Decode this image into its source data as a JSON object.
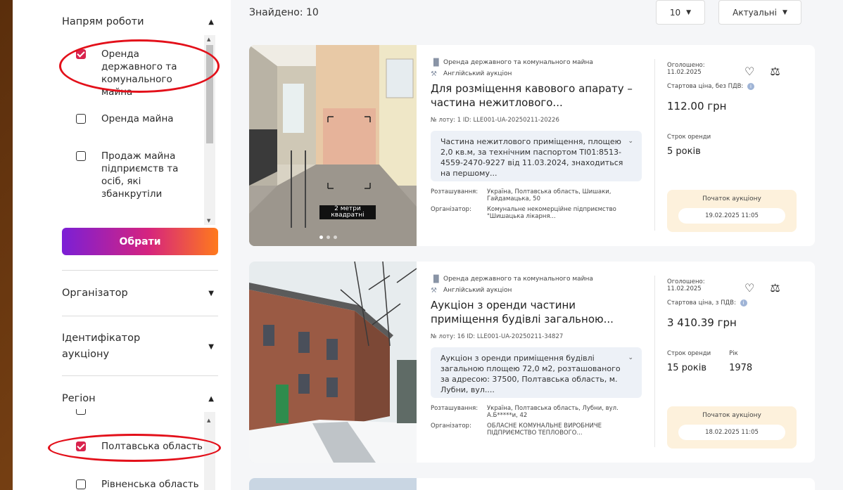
{
  "sidebar": {
    "sections": {
      "direction": {
        "title": "Напрям роботи"
      },
      "organizer": {
        "title": "Організатор"
      },
      "auction_id": {
        "title": "Ідентифікатор аукціону"
      },
      "region": {
        "title": "Регіон"
      }
    },
    "direction_options": [
      {
        "label": "Оренда державного та комунального майна",
        "checked": true
      },
      {
        "label": "Оренда майна",
        "checked": false
      },
      {
        "label": "Продаж майна підприємств та осіб, які збанкрутіли",
        "checked": false
      }
    ],
    "choose_button": "Обрати",
    "region_options": [
      {
        "label": "Полтавська область",
        "checked": true
      },
      {
        "label": "Рівненська область",
        "checked": false
      }
    ]
  },
  "toolbar": {
    "found": "Знайдено: 10",
    "per_page": "10",
    "sort": "Актуальні"
  },
  "cards": [
    {
      "category": "Оренда державного та комунального майна",
      "auction_type": "Англійський аукціон",
      "title": "Для розміщення кавового апарату – частина нежитлового...",
      "lot": "№ лоту: 1    ID: LLE001-UA-20250211-20226",
      "description": "Частина нежитлового приміщення, площею 2,0 кв.м, за технічним паспортом ТІ01:8513-4559-2470-9227 від 11.03.2024, знаходиться на першому...",
      "location_label": "Розташування:",
      "location": "Україна, Полтавська область, Шишаки, Гайдамацька, 50",
      "organizer_label": "Організатор:",
      "organizer": "Комунальне некомерційне підприємство \"Шишацька лікарня...",
      "announced_label": "Оголошено:",
      "announced": "11.02.2025",
      "price_label": "Стартова ціна, без ПДВ:",
      "price": "112.00 грн",
      "term_label": "Строк оренди",
      "term": "5 років",
      "auction_start_label": "Початок аукціону",
      "auction_start": "19.02.2025 11:05",
      "photo_caption": "2 метри квадратні"
    },
    {
      "category": "Оренда державного та комунального майна",
      "auction_type": "Англійський аукціон",
      "title": "Аукціон з оренди частини приміщення будівлі загальною...",
      "lot": "№ лоту: 16    ID: LLE001-UA-20250211-34827",
      "description": "Аукціон з оренди приміщення будівлі загальною площею 72,0 м2, розташованого за адресою: 37500, Полтавська область, м. Лубни, вул....",
      "location_label": "Розташування:",
      "location": "Україна, Полтавська область, Лубни, вул. А.Б*****и, 42",
      "organizer_label": "Організатор:",
      "organizer": "ОБЛАСНЕ КОМУНАЛЬНЕ ВИРОБНИЧЕ ПІДПРИЄМСТВО ТЕПЛОВОГО...",
      "announced_label": "Оголошено:",
      "announced": "11.02.2025",
      "price_label": "Стартова ціна, з ПДВ:",
      "price": "3 410.39 грн",
      "term_label": "Строк оренди",
      "term": "15 років",
      "year_label": "Рік",
      "year": "1978",
      "auction_start_label": "Початок аукціону",
      "auction_start": "18.02.2025 11:05"
    }
  ],
  "icons": {
    "favorite": "heart-icon",
    "compare": "scales-icon",
    "category": "building-icon",
    "auction": "gavel-icon",
    "info": "info-icon"
  },
  "colors": {
    "checked": "#d9234d",
    "annotation": "#e3101a",
    "button_gradient": [
      "#7b1fd6",
      "#d5237f",
      "#ff7a1c"
    ],
    "auction_box": "#fdf1dc"
  }
}
